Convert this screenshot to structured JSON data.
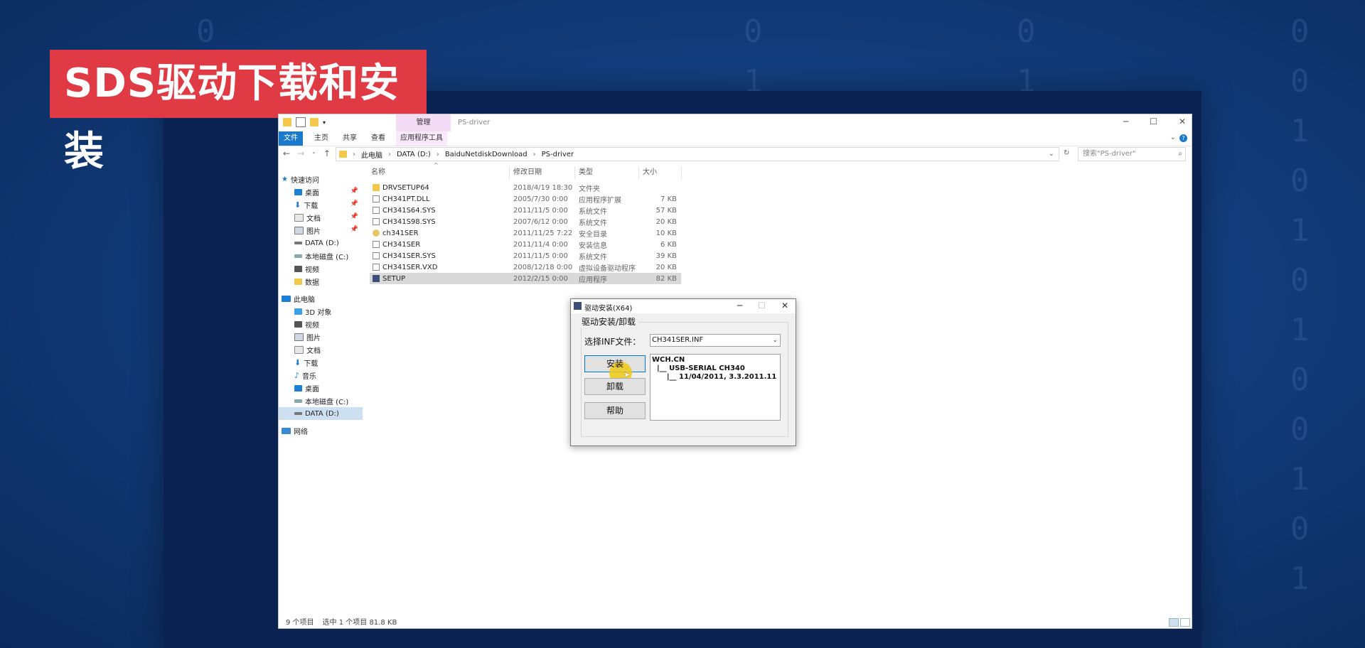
{
  "banner": {
    "title": "SDS驱动下载和安装"
  },
  "explorer": {
    "title": "PS-driver",
    "manage_tab": "管理",
    "ribbon_tabs": [
      "文件",
      "主页",
      "共享",
      "查看",
      "应用程序工具"
    ],
    "breadcrumb": [
      "此电脑",
      "DATA (D:)",
      "BaiduNetdiskDownload",
      "PS-driver"
    ],
    "search_placeholder": "搜索\"PS-driver\"",
    "nav": {
      "quick_access": "快速访问",
      "quick_items": [
        "桌面",
        "下载",
        "文档",
        "图片",
        "DATA (D:)",
        "本地磁盘 (C:)",
        "视频",
        "数据"
      ],
      "this_pc": "此电脑",
      "pc_items": [
        "3D 对象",
        "视频",
        "图片",
        "文档",
        "下载",
        "音乐",
        "桌面",
        "本地磁盘 (C:)",
        "DATA (D:)"
      ],
      "network": "网络"
    },
    "columns": {
      "name": "名称",
      "date": "修改日期",
      "type": "类型",
      "size": "大小"
    },
    "files": [
      {
        "name": "DRVSETUP64",
        "date": "2018/4/19 18:30",
        "type": "文件夹",
        "size": "",
        "icon": "folder"
      },
      {
        "name": "CH341PT.DLL",
        "date": "2005/7/30 0:00",
        "type": "应用程序扩展",
        "size": "7 KB",
        "icon": "doc"
      },
      {
        "name": "CH341S64.SYS",
        "date": "2011/11/5 0:00",
        "type": "系统文件",
        "size": "57 KB",
        "icon": "doc"
      },
      {
        "name": "CH341S98.SYS",
        "date": "2007/6/12 0:00",
        "type": "系统文件",
        "size": "20 KB",
        "icon": "doc"
      },
      {
        "name": "ch341SER",
        "date": "2011/11/25 7:22",
        "type": "安全目录",
        "size": "10 KB",
        "icon": "cat"
      },
      {
        "name": "CH341SER",
        "date": "2011/11/4 0:00",
        "type": "安装信息",
        "size": "6 KB",
        "icon": "doc"
      },
      {
        "name": "CH341SER.SYS",
        "date": "2011/11/5 0:00",
        "type": "系统文件",
        "size": "39 KB",
        "icon": "doc"
      },
      {
        "name": "CH341SER.VXD",
        "date": "2008/12/18 0:00",
        "type": "虚拟设备驱动程序",
        "size": "20 KB",
        "icon": "doc"
      },
      {
        "name": "SETUP",
        "date": "2012/2/15 0:00",
        "type": "应用程序",
        "size": "82 KB",
        "icon": "exe"
      }
    ],
    "status": {
      "count": "9 个项目",
      "selected": "选中 1 个项目  81.8 KB"
    }
  },
  "dialog": {
    "title": "驱动安装(X64)",
    "group_label": "驱动安装/卸载",
    "inf_label": "选择INF文件：",
    "inf_value": "CH341SER.INF",
    "install": "安装",
    "uninstall": "卸载",
    "help": "帮助",
    "info": "WCH.CN\n  |__ USB-SERIAL CH340\n      |__ 11/04/2011, 3.3.2011.11"
  }
}
